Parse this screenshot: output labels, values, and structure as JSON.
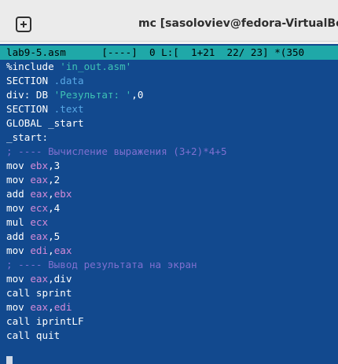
{
  "window": {
    "title": "mc [sasoloviev@fedora-VirtualBox]:~/"
  },
  "editor": {
    "status": "lab9-5.asm      [----]  0 L:[  1+21  22/ 23] *(350",
    "lines": [
      [
        {
          "t": "%include ",
          "c": "plain"
        },
        {
          "t": "'in_out.asm'",
          "c": "string"
        }
      ],
      [
        {
          "t": "SECTION ",
          "c": "plain"
        },
        {
          "t": ".data",
          "c": "dir"
        }
      ],
      [
        {
          "t": "div: DB ",
          "c": "plain"
        },
        {
          "t": "'Результат: '",
          "c": "string"
        },
        {
          "t": ",0",
          "c": "plain"
        }
      ],
      [
        {
          "t": "SECTION ",
          "c": "plain"
        },
        {
          "t": ".text",
          "c": "dir"
        }
      ],
      [
        {
          "t": "GLOBAL _start",
          "c": "plain"
        }
      ],
      [
        {
          "t": "_start:",
          "c": "plain"
        }
      ],
      [
        {
          "t": "; ---- Вычисление выражения (3+2)*4+5",
          "c": "comment"
        }
      ],
      [
        {
          "t": "mov ",
          "c": "plain"
        },
        {
          "t": "ebx",
          "c": "reg"
        },
        {
          "t": ",3",
          "c": "plain"
        }
      ],
      [
        {
          "t": "mov ",
          "c": "plain"
        },
        {
          "t": "eax",
          "c": "reg"
        },
        {
          "t": ",2",
          "c": "plain"
        }
      ],
      [
        {
          "t": "add ",
          "c": "plain"
        },
        {
          "t": "eax",
          "c": "reg"
        },
        {
          "t": ",",
          "c": "plain"
        },
        {
          "t": "ebx",
          "c": "reg"
        }
      ],
      [
        {
          "t": "mov ",
          "c": "plain"
        },
        {
          "t": "ecx",
          "c": "reg"
        },
        {
          "t": ",4",
          "c": "plain"
        }
      ],
      [
        {
          "t": "mul ",
          "c": "plain"
        },
        {
          "t": "ecx",
          "c": "reg"
        }
      ],
      [
        {
          "t": "add ",
          "c": "plain"
        },
        {
          "t": "eax",
          "c": "reg"
        },
        {
          "t": ",5",
          "c": "plain"
        }
      ],
      [
        {
          "t": "mov ",
          "c": "plain"
        },
        {
          "t": "edi",
          "c": "reg"
        },
        {
          "t": ",",
          "c": "plain"
        },
        {
          "t": "eax",
          "c": "reg"
        }
      ],
      [
        {
          "t": "; ---- Вывод результата на экран",
          "c": "comment"
        }
      ],
      [
        {
          "t": "mov ",
          "c": "plain"
        },
        {
          "t": "eax",
          "c": "reg"
        },
        {
          "t": ",div",
          "c": "plain"
        }
      ],
      [
        {
          "t": "call sprint",
          "c": "plain"
        }
      ],
      [
        {
          "t": "mov ",
          "c": "plain"
        },
        {
          "t": "eax",
          "c": "reg"
        },
        {
          "t": ",",
          "c": "plain"
        },
        {
          "t": "edi",
          "c": "reg"
        }
      ],
      [
        {
          "t": "call iprintLF",
          "c": "plain"
        }
      ],
      [
        {
          "t": "call quit",
          "c": "plain"
        }
      ]
    ]
  },
  "icons": {
    "new_tab": "new-tab-icon"
  },
  "colors": {
    "editor_background": "#12498e",
    "status_bar": "#1fa8a8",
    "string": "#3ec3b5",
    "register": "#d38ad8",
    "directive": "#58a8e6",
    "comment": "#7f70d0"
  }
}
